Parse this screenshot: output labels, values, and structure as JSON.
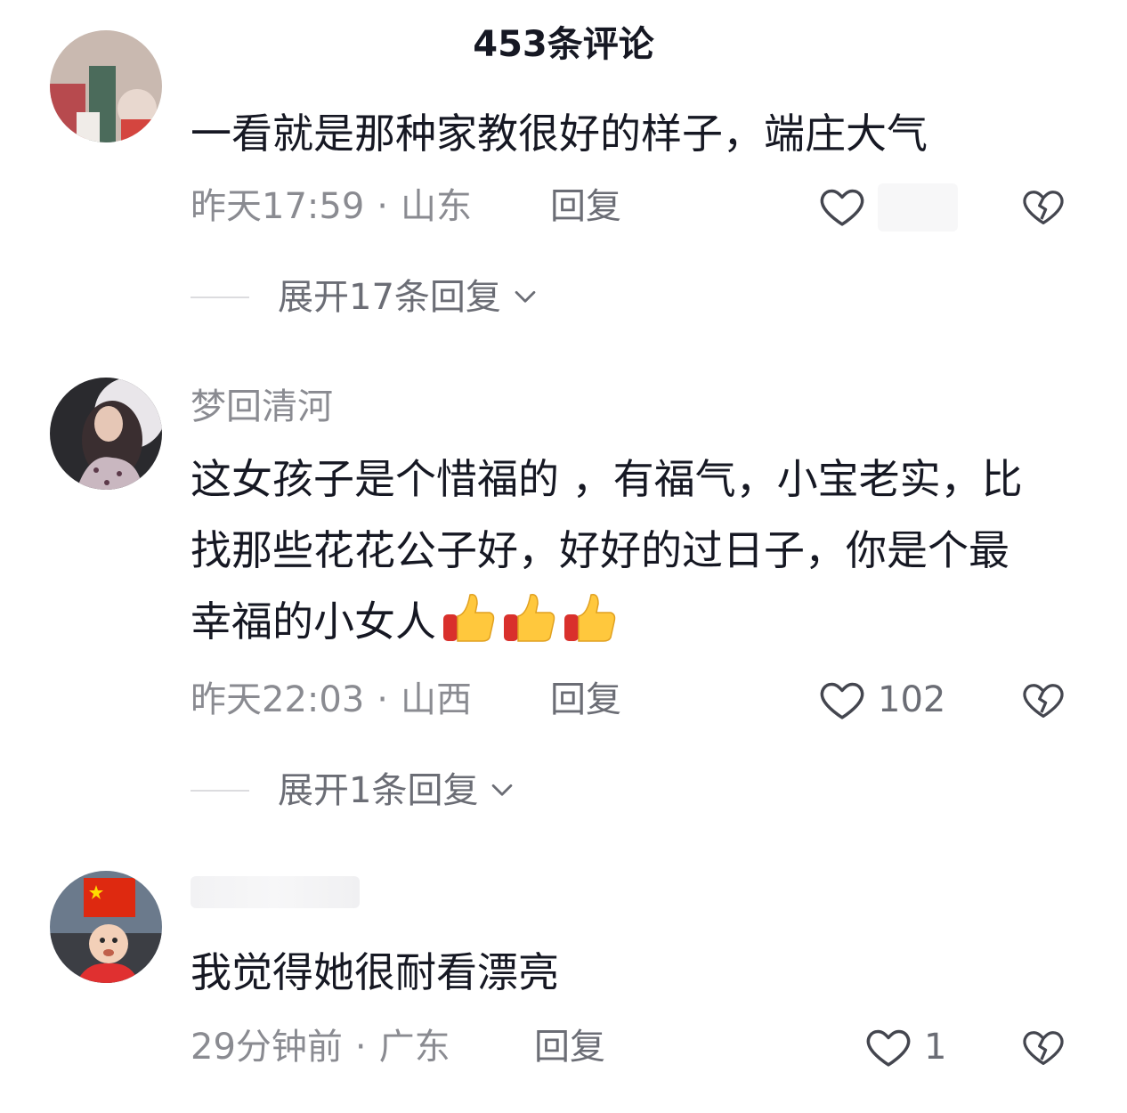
{
  "header": {
    "title": "453条评论"
  },
  "comments": [
    {
      "username": "",
      "text": "一看就是那种家教很好的样子，端庄大气",
      "time": "昨天17:59",
      "location": "山东",
      "reply_label": "回复",
      "like_count": "",
      "expand_label": "展开17条回复"
    },
    {
      "username": "梦回清河",
      "text": "这女孩子是个惜福的 ，有福气，小宝老实，比找那些花花公子好，好好的过日子，你是个最幸福的小女人",
      "time": "昨天22:03",
      "location": "山西",
      "reply_label": "回复",
      "like_count": "102",
      "expand_label": "展开1条回复"
    },
    {
      "username": "",
      "text": "我觉得她很耐看漂亮",
      "time": "29分钟前",
      "location": "广东",
      "reply_label": "回复",
      "like_count": "1"
    }
  ],
  "meta_separator": "·",
  "colors": {
    "text_primary": "#161823",
    "text_secondary": "#8a8b91",
    "accent_thumb": "#ffc83d"
  },
  "icons": [
    "heart-outline-icon",
    "broken-heart-icon",
    "chevron-down-icon",
    "thumbs-up-emoji"
  ]
}
